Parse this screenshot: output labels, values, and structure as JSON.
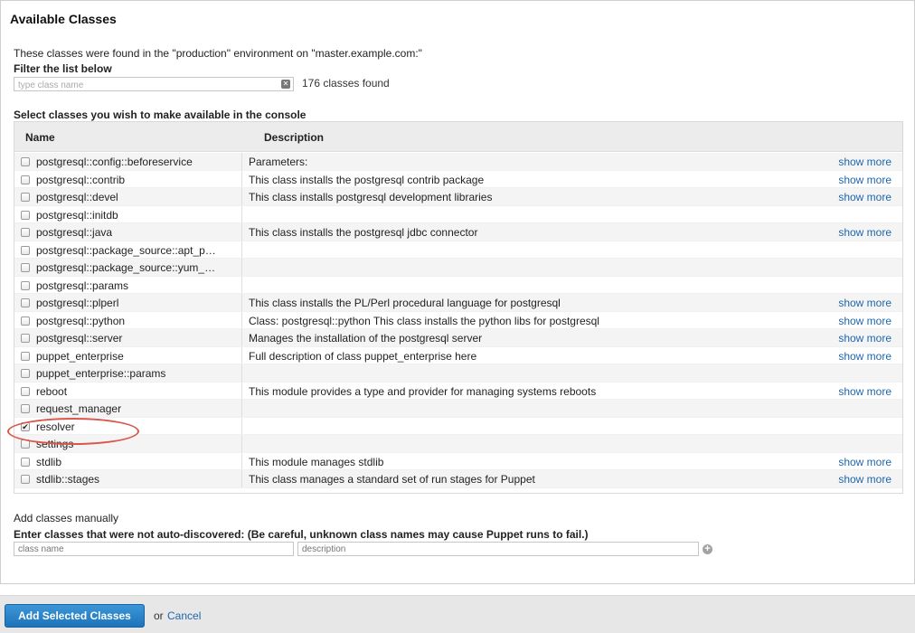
{
  "panel": {
    "title": "Available Classes",
    "intro": "These classes were found in the \"production\" environment on \"master.example.com:\"",
    "filter_label": "Filter the list below",
    "filter_placeholder": "type class name",
    "count_text": "176 classes found",
    "select_label": "Select classes you wish to make available in the console"
  },
  "table": {
    "columns": {
      "name": "Name",
      "description": "Description"
    },
    "show_more_label": "show more",
    "rows": [
      {
        "name": "postgresql::config::beforeservice",
        "description": "Parameters:",
        "show_more": true,
        "checked": false
      },
      {
        "name": "postgresql::contrib",
        "description": "This class installs the postgresql contrib package",
        "show_more": true,
        "checked": false
      },
      {
        "name": "postgresql::devel",
        "description": "This class installs postgresql development libraries",
        "show_more": true,
        "checked": false
      },
      {
        "name": "postgresql::initdb",
        "description": "",
        "show_more": false,
        "checked": false
      },
      {
        "name": "postgresql::java",
        "description": "This class installs the postgresql jdbc connector",
        "show_more": true,
        "checked": false
      },
      {
        "name": "postgresql::package_source::apt_p…",
        "description": "",
        "show_more": false,
        "checked": false
      },
      {
        "name": "postgresql::package_source::yum_…",
        "description": "",
        "show_more": false,
        "checked": false
      },
      {
        "name": "postgresql::params",
        "description": "",
        "show_more": false,
        "checked": false
      },
      {
        "name": "postgresql::plperl",
        "description": "This class installs the PL/Perl procedural language for postgresql",
        "show_more": true,
        "checked": false
      },
      {
        "name": "postgresql::python",
        "description": "Class: postgresql::python This class installs the python libs for postgresql",
        "show_more": true,
        "checked": false
      },
      {
        "name": "postgresql::server",
        "description": "Manages the installation of the postgresql server",
        "show_more": true,
        "checked": false
      },
      {
        "name": "puppet_enterprise",
        "description": "Full description of class puppet_enterprise here",
        "show_more": true,
        "checked": false
      },
      {
        "name": "puppet_enterprise::params",
        "description": "",
        "show_more": false,
        "checked": false
      },
      {
        "name": "reboot",
        "description": "This module provides a type and provider for managing systems reboots",
        "show_more": true,
        "checked": false
      },
      {
        "name": "request_manager",
        "description": "",
        "show_more": false,
        "checked": false
      },
      {
        "name": "resolver",
        "description": "",
        "show_more": false,
        "checked": true
      },
      {
        "name": "settings",
        "description": "",
        "show_more": false,
        "checked": false
      },
      {
        "name": "stdlib",
        "description": "This module manages stdlib",
        "show_more": true,
        "checked": false
      },
      {
        "name": "stdlib::stages",
        "description": "This class manages a standard set of run stages for Puppet",
        "show_more": true,
        "checked": false
      }
    ]
  },
  "manual": {
    "title": "Add classes manually",
    "label": "Enter classes that were not auto-discovered: (Be careful, unknown class names may cause Puppet runs to fail.)",
    "class_name_placeholder": "class name",
    "description_placeholder": "description"
  },
  "footer": {
    "primary_label": "Add Selected Classes",
    "or_text": "or",
    "cancel_label": "Cancel"
  },
  "colors": {
    "accent": "#1f73b8",
    "link": "#1f66ad",
    "highlight": "#d9574a"
  }
}
